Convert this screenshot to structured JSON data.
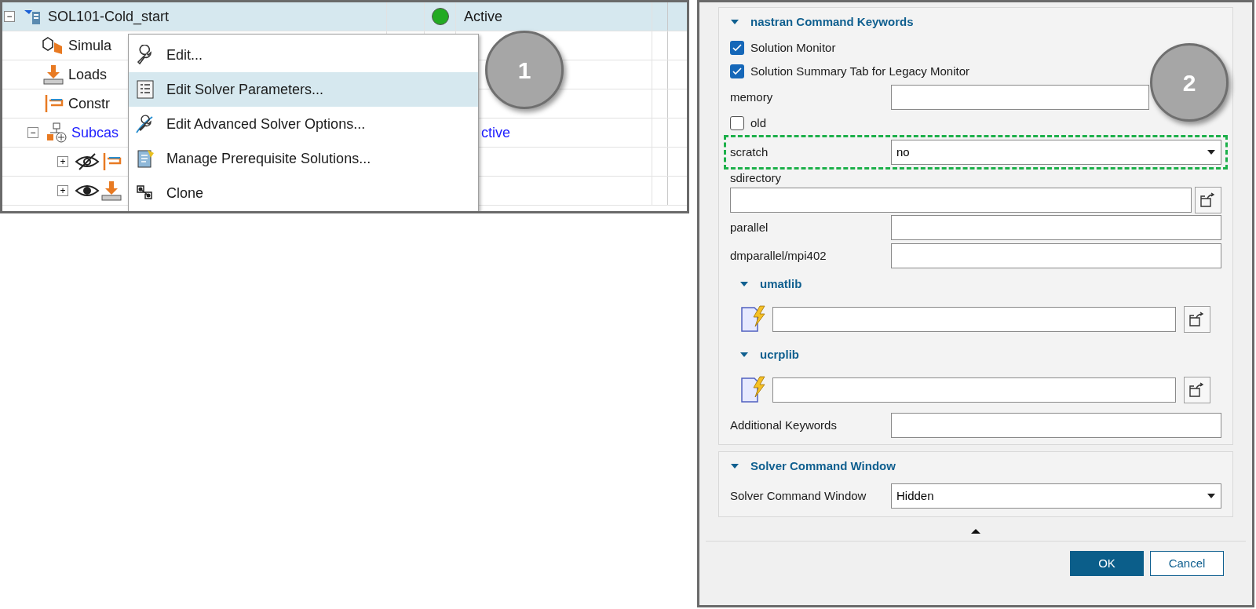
{
  "tree": {
    "rows": [
      {
        "toggle": "−",
        "kind": "solution",
        "label": "SOL101-Cold_start",
        "selected": true,
        "status": "Active",
        "link": false
      },
      {
        "kind": "simulation",
        "label": "Simula",
        "selected": false,
        "link": false
      },
      {
        "kind": "load",
        "label": "Loads",
        "selected": false,
        "link": false
      },
      {
        "kind": "constraint",
        "label": "Constr",
        "selected": false,
        "link": false
      },
      {
        "toggle": "−",
        "kind": "subcase",
        "label": "Subcas",
        "selected": false,
        "status": "ctive",
        "link": true
      },
      {
        "toggle": "+",
        "kind": "hidden-constraint",
        "selected": false
      },
      {
        "toggle": "+",
        "kind": "visible-load",
        "selected": false
      }
    ]
  },
  "context_menu": {
    "items": [
      {
        "kind": "wrench",
        "label": "Edit...",
        "selected": false
      },
      {
        "kind": "list",
        "label": "Edit Solver Parameters...",
        "selected": true
      },
      {
        "kind": "advanced",
        "label": "Edit Advanced Solver Options...",
        "selected": false
      },
      {
        "kind": "prereq",
        "label": "Manage Prerequisite Solutions...",
        "selected": false
      },
      {
        "kind": "clone",
        "label": "Clone",
        "selected": false
      }
    ]
  },
  "callouts": [
    "1",
    "2"
  ],
  "dialog": {
    "sections": [
      {
        "title": "nastran Command Keywords",
        "expanded": true,
        "fields": [
          {
            "kind": "checkbox",
            "label": "Solution Monitor",
            "checked": true
          },
          {
            "kind": "checkbox",
            "label": "Solution Summary Tab for Legacy Monitor",
            "checked": true
          },
          {
            "kind": "text",
            "label": "memory"
          },
          {
            "kind": "checkbox",
            "label": "old",
            "checked": false
          },
          {
            "kind": "combo",
            "label": "scratch",
            "value": "no",
            "highlighted": true
          },
          {
            "kind": "path",
            "label": "sdirectory"
          },
          {
            "kind": "text",
            "label": "parallel"
          },
          {
            "kind": "text",
            "label": "dmparallel/mpi402"
          },
          {
            "kind": "subsection",
            "label": "umatlib"
          },
          {
            "kind": "file"
          },
          {
            "kind": "subsection",
            "label": "ucrplib"
          },
          {
            "kind": "file"
          },
          {
            "kind": "text",
            "label": "Additional Keywords"
          }
        ]
      },
      {
        "title": "Solver Command Window",
        "expanded": true,
        "fields": [
          {
            "kind": "combo",
            "label": "Solver Command Window",
            "value": "Hidden",
            "highlighted": false
          }
        ]
      }
    ],
    "buttons": [
      {
        "label": "OK",
        "primary": true
      },
      {
        "label": "Cancel",
        "primary": false
      }
    ]
  }
}
